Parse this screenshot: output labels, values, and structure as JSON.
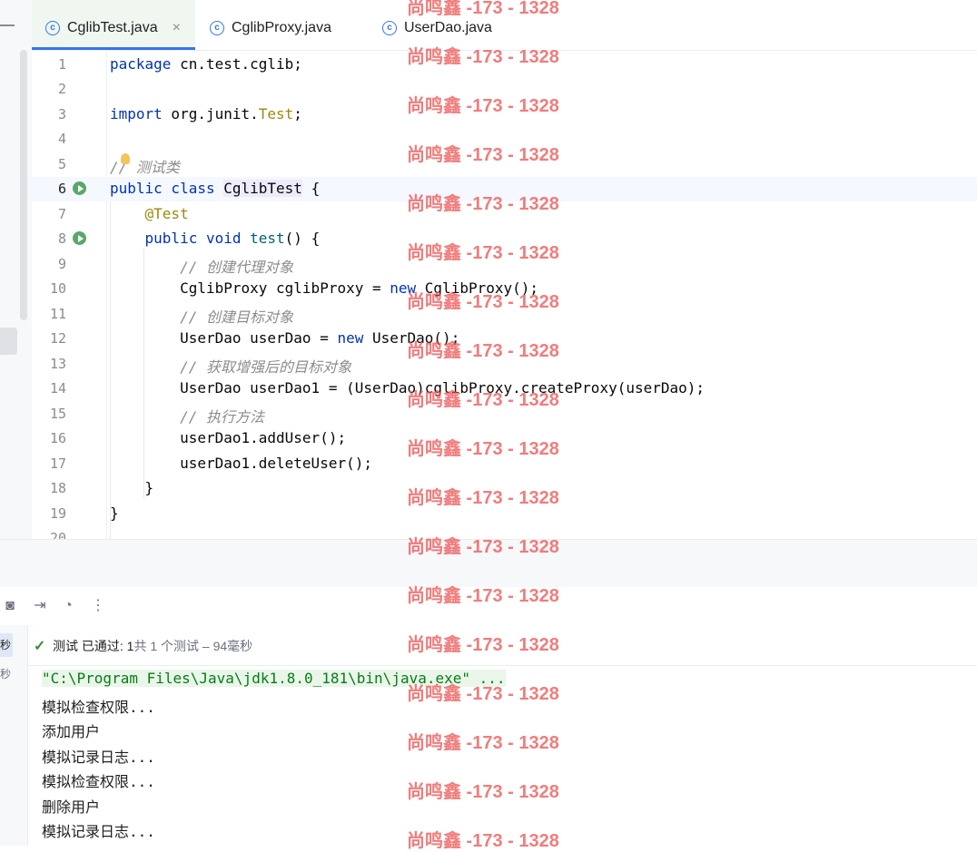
{
  "tabs": [
    {
      "label": "CglibTest.java",
      "active": true,
      "icon": "class-icon"
    },
    {
      "label": "CglibProxy.java",
      "active": false,
      "icon": "class-icon"
    },
    {
      "label": "UserDao.java",
      "active": false,
      "icon": "class-icon"
    }
  ],
  "editor": {
    "lines": [
      {
        "num": "1",
        "text": "package cn.test.cglib;"
      },
      {
        "num": "2",
        "text": ""
      },
      {
        "num": "3",
        "text": "import org.junit.Test;"
      },
      {
        "num": "4",
        "text": ""
      },
      {
        "num": "5",
        "text": "// 测试类"
      },
      {
        "num": "6",
        "text": "public class CglibTest {"
      },
      {
        "num": "7",
        "text": "    @Test"
      },
      {
        "num": "8",
        "text": "    public void test() {"
      },
      {
        "num": "9",
        "text": "        // 创建代理对象"
      },
      {
        "num": "10",
        "text": "        CglibProxy cglibProxy = new CglibProxy();"
      },
      {
        "num": "11",
        "text": "        // 创建目标对象"
      },
      {
        "num": "12",
        "text": "        UserDao userDao = new UserDao();"
      },
      {
        "num": "13",
        "text": "        // 获取增强后的目标对象"
      },
      {
        "num": "14",
        "text": "        UserDao userDao1 = (UserDao)cglibProxy.createProxy(userDao);"
      },
      {
        "num": "15",
        "text": "        // 执行方法"
      },
      {
        "num": "16",
        "text": "        userDao1.addUser();"
      },
      {
        "num": "17",
        "text": "        userDao1.deleteUser();"
      },
      {
        "num": "18",
        "text": "    }"
      },
      {
        "num": "19",
        "text": "}"
      },
      {
        "num": "20",
        "text": ""
      }
    ]
  },
  "test_status": {
    "label": "测试 已通过:",
    "count": "1",
    "detail": "共 1 个测试 – 94毫秒"
  },
  "left_panel": {
    "items": [
      "秒",
      "秒"
    ]
  },
  "console": {
    "command": "\"C:\\Program Files\\Java\\jdk1.8.0_181\\bin\\java.exe\" ...",
    "lines": [
      "模拟检查权限...",
      "添加用户",
      "模拟记录日志...",
      "模拟检查权限...",
      "删除用户",
      "模拟记录日志..."
    ]
  },
  "watermark": "尚鸣鑫 -173 - 1328",
  "colors": {
    "accent": "#3574f0",
    "keyword": "#0033b3",
    "annotation": "#9e880d",
    "watermark": "#ee5050",
    "success": "#3d8c40"
  }
}
